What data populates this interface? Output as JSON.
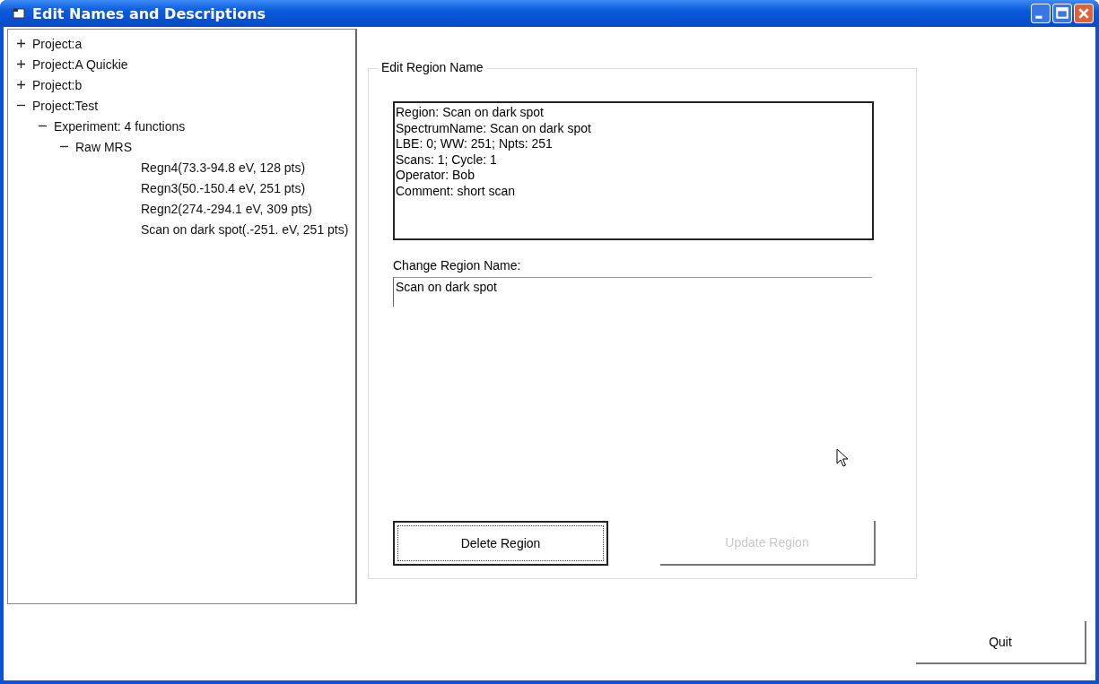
{
  "window": {
    "title": "Edit Names and Descriptions"
  },
  "tree": [
    {
      "kind": "node",
      "label": "Project:a",
      "expanded": false
    },
    {
      "kind": "node",
      "label": "Project:A Quickie",
      "expanded": false
    },
    {
      "kind": "node",
      "label": "Project:b",
      "expanded": false
    },
    {
      "kind": "node",
      "label": "Project:Test",
      "expanded": true,
      "children": [
        {
          "kind": "node",
          "label": "Experiment: 4 functions",
          "expanded": true,
          "children": [
            {
              "kind": "node",
              "label": "Raw MRS",
              "expanded": true,
              "children": [
                {
                  "kind": "leaf",
                  "label": "Regn4(73.3-94.8 eV, 128 pts)"
                },
                {
                  "kind": "leaf",
                  "label": "Regn3(50.-150.4 eV, 251 pts)"
                },
                {
                  "kind": "leaf",
                  "label": "Regn2(274.-294.1 eV, 309 pts)"
                },
                {
                  "kind": "leaf",
                  "label": "Scan on dark spot(.-251. eV, 251 pts)"
                }
              ]
            }
          ]
        }
      ]
    }
  ],
  "group": {
    "title": "Edit Region Name",
    "details": [
      "Region: Scan on dark spot",
      "SpectrumName: Scan on dark spot",
      "LBE: 0; WW: 251; Npts: 251",
      "Scans: 1; Cycle: 1",
      "Operator: Bob",
      "Comment: short scan"
    ],
    "field": {
      "label": "Change Region Name:",
      "value": "Scan on dark spot"
    },
    "buttons": [
      {
        "label": "Delete Region",
        "disabled": false,
        "focused": true
      },
      {
        "label": "Update Region",
        "disabled": true,
        "focused": false
      }
    ]
  },
  "quit": {
    "label": "Quit"
  }
}
